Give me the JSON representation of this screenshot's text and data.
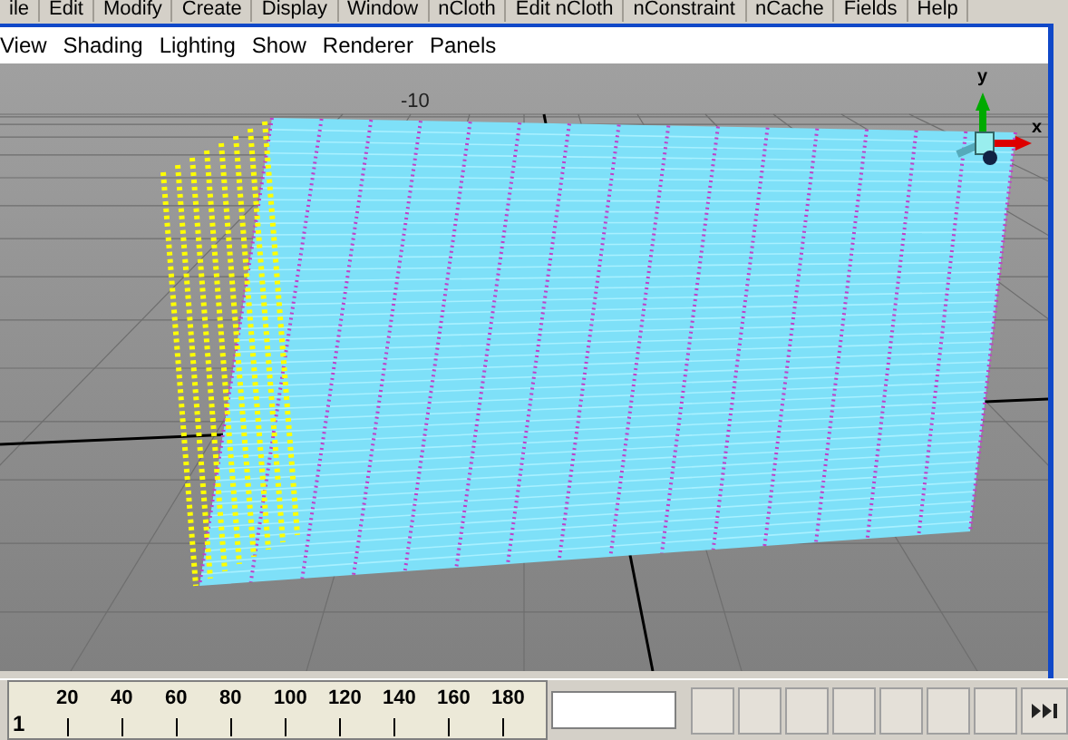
{
  "menu_bar": [
    "ile",
    "Edit",
    "Modify",
    "Create",
    "Display",
    "Window",
    "nCloth",
    "Edit nCloth",
    "nConstraint",
    "nCache",
    "Fields",
    "Help"
  ],
  "panel_menu": [
    "View",
    "Shading",
    "Lighting",
    "Show",
    "Renderer",
    "Panels"
  ],
  "viewport": {
    "grid_label": "-10",
    "axis_y": "y",
    "axis_x": "x"
  },
  "timeline": {
    "start": "1",
    "ticks": [
      "20",
      "40",
      "60",
      "80",
      "100",
      "120",
      "140",
      "160",
      "180"
    ]
  }
}
